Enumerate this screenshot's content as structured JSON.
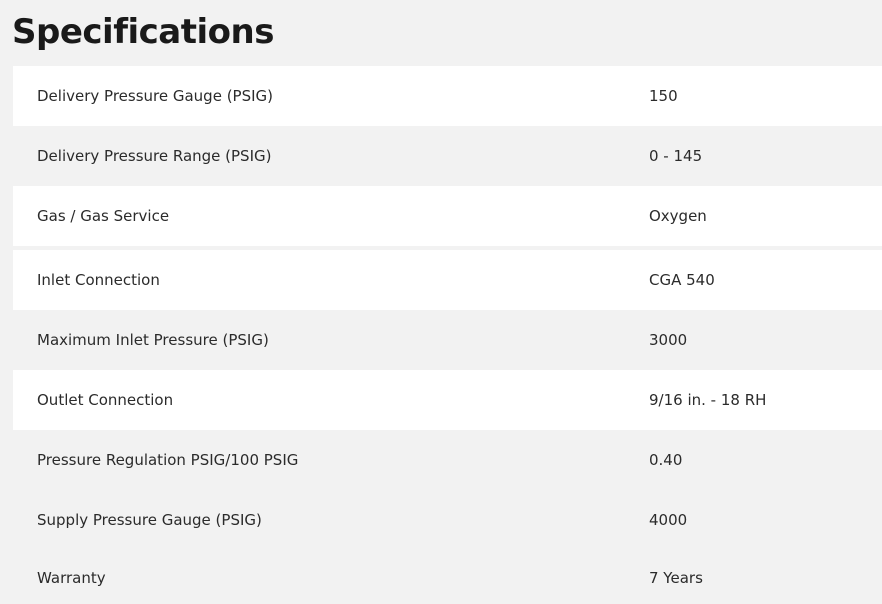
{
  "page": {
    "title": "Specifications"
  },
  "colors": {
    "stripe": "#ffffff",
    "alt": "#f2f2f2",
    "text": "#222222"
  },
  "specs": [
    {
      "label": "Delivery Pressure Gauge (PSIG)",
      "value": "150"
    },
    {
      "label": "Delivery Pressure Range (PSIG)",
      "value": "0 - 145"
    },
    {
      "label": "Gas / Gas Service",
      "value": "Oxygen"
    },
    {
      "label": "Inlet Connection",
      "value": "CGA 540"
    },
    {
      "label": "Maximum Inlet Pressure (PSIG)",
      "value": "3000"
    },
    {
      "label": "Outlet Connection",
      "value": "9/16 in. - 18 RH"
    },
    {
      "label": "Pressure Regulation PSIG/100 PSIG",
      "value": "0.40"
    },
    {
      "label": "Supply Pressure Gauge (PSIG)",
      "value": "4000"
    },
    {
      "label": "Warranty",
      "value": "7 Years"
    }
  ]
}
